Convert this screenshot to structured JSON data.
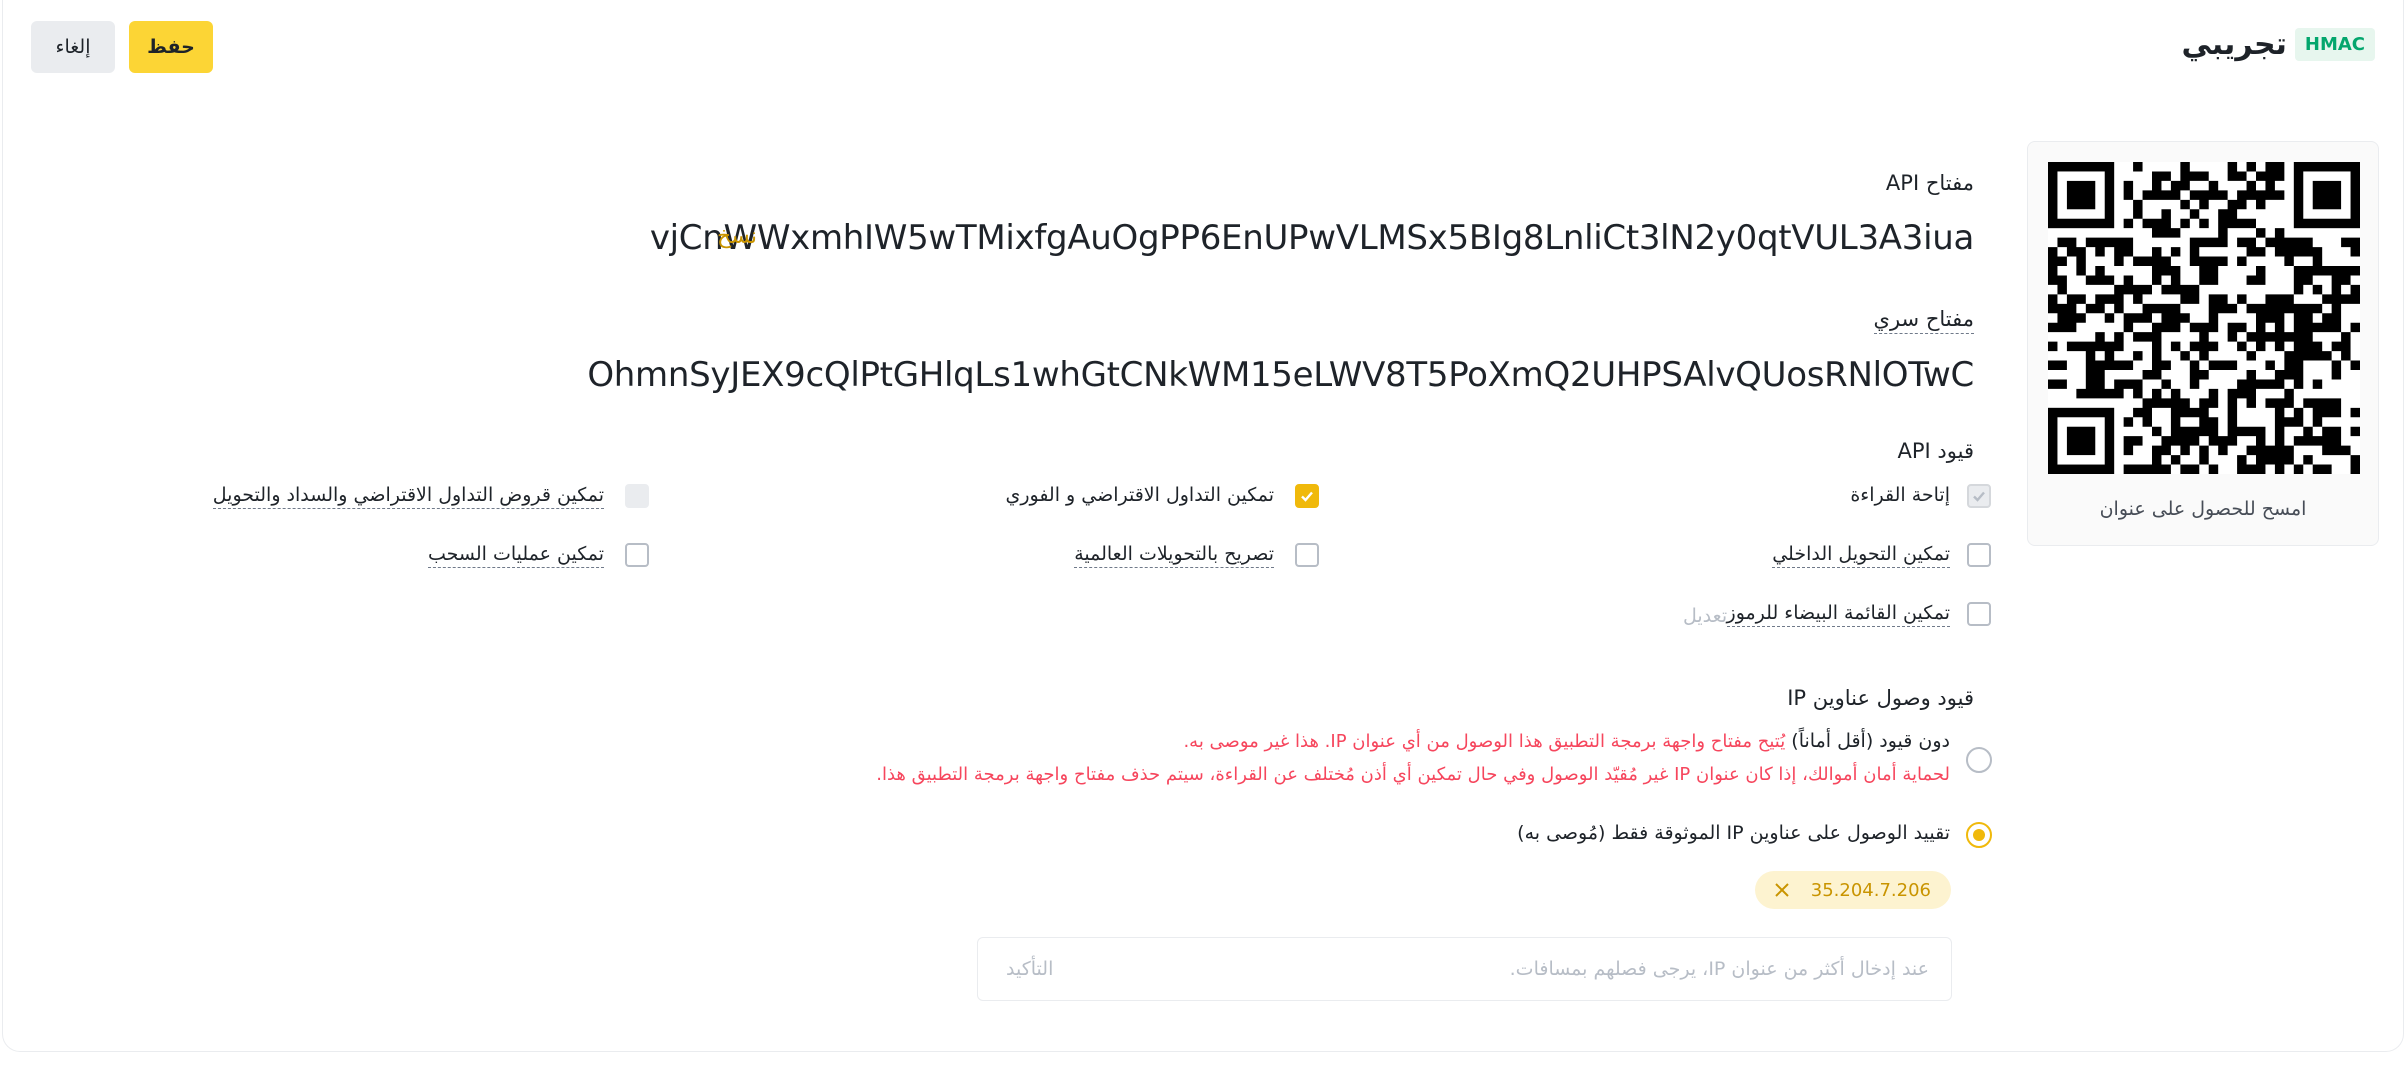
{
  "header": {
    "title": "تجريبي",
    "badge": "HMAC",
    "save_label": "حفظ",
    "cancel_label": "إلغاء"
  },
  "qr": {
    "caption": "امسح للحصول على عنوان"
  },
  "api_key": {
    "label": "مفتاح API",
    "value": "vjCnWWxmhIW5wTMixfgAuOgPP6EnUPwVLMSx5BIg8LnliCt3lN2y0qtVUL3A3iua",
    "copy_label": "نسخ"
  },
  "secret_key": {
    "label": "مفتاح سري",
    "value": "OhmnSyJEX9cQlPtGHlqLs1whGtCNkWM15eLWV8T5PoXmQ2UHPSAlvQUosRNlOTwC"
  },
  "restrictions": {
    "label": "قيود API",
    "permissions": [
      {
        "label": "إتاحة القراءة",
        "checked": true,
        "disabled": true
      },
      {
        "label": "تمكين التداول الاقتراضي و الفوري",
        "checked": true,
        "disabled": false
      },
      {
        "label": "تمكين قروض التداول الاقتراضي والسداد والتحويل",
        "checked": false,
        "disabled": true
      },
      {
        "label": "تمكين التحويل الداخلي",
        "checked": false,
        "disabled": false
      },
      {
        "label": "تصريح بالتحويلات العالمية",
        "checked": false,
        "disabled": false
      },
      {
        "label": "تمكين عمليات السحب",
        "checked": false,
        "disabled": false
      },
      {
        "label": "تمكين القائمة البيضاء للرموز",
        "checked": false,
        "disabled": false
      }
    ],
    "edit_label": "تعديل"
  },
  "ip_access": {
    "label": "قيود وصول عناوين IP",
    "unrestricted": {
      "label": "دون قيود (أقل أماناً)",
      "warning_line1": "يُتيح مفتاح واجهة برمجة التطبيق هذا الوصول من أي عنوان IP. هذا غير موصى به.",
      "warning_line2": "لحماية أمان أموالك، إذا كان عنوان IP غير مُقيّد الوصول وفي حال تمكين أي أذن مُختلف عن القراءة، سيتم حذف مفتاح واجهة برمجة التطبيق هذا.",
      "selected": false
    },
    "restricted": {
      "label": "تقييد الوصول على عناوين IP الموثوقة فقط (مُوصى به)",
      "selected": true
    },
    "ips": [
      "35.204.7.206"
    ],
    "input_placeholder": "عند إدخال أكثر من عنوان IP، يرجى فصلهم بمسافات.",
    "confirm_label": "التأكيد"
  },
  "colors": {
    "accent": "#fcd535",
    "checkbox_checked": "#f0b90b",
    "link": "#c99400",
    "warning": "#f6465d",
    "badge_green": "#03a66d"
  }
}
